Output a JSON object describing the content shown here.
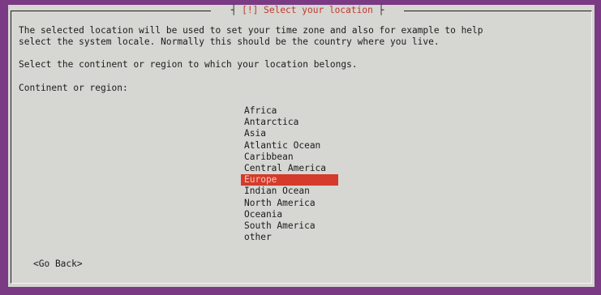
{
  "dialog": {
    "title": "[!] Select your location",
    "description": "The selected location will be used to set your time zone and also for example to help\nselect the system locale. Normally this should be the country where you live.",
    "prompt": "Select the continent or region to which your location belongs.",
    "list_label": "Continent or region:",
    "selected_index": 6,
    "regions": [
      {
        "label": "Africa"
      },
      {
        "label": "Antarctica"
      },
      {
        "label": "Asia"
      },
      {
        "label": "Atlantic Ocean"
      },
      {
        "label": "Caribbean"
      },
      {
        "label": "Central America"
      },
      {
        "label": "Europe"
      },
      {
        "label": "Indian Ocean"
      },
      {
        "label": "North America"
      },
      {
        "label": "Oceania"
      },
      {
        "label": "South America"
      },
      {
        "label": "other"
      }
    ],
    "go_back_label": "<Go Back>"
  },
  "colors": {
    "background": "#7a3a84",
    "dialog": "#d6d6d3",
    "highlight": "#d43b2a",
    "title_text": "#c0392b"
  }
}
